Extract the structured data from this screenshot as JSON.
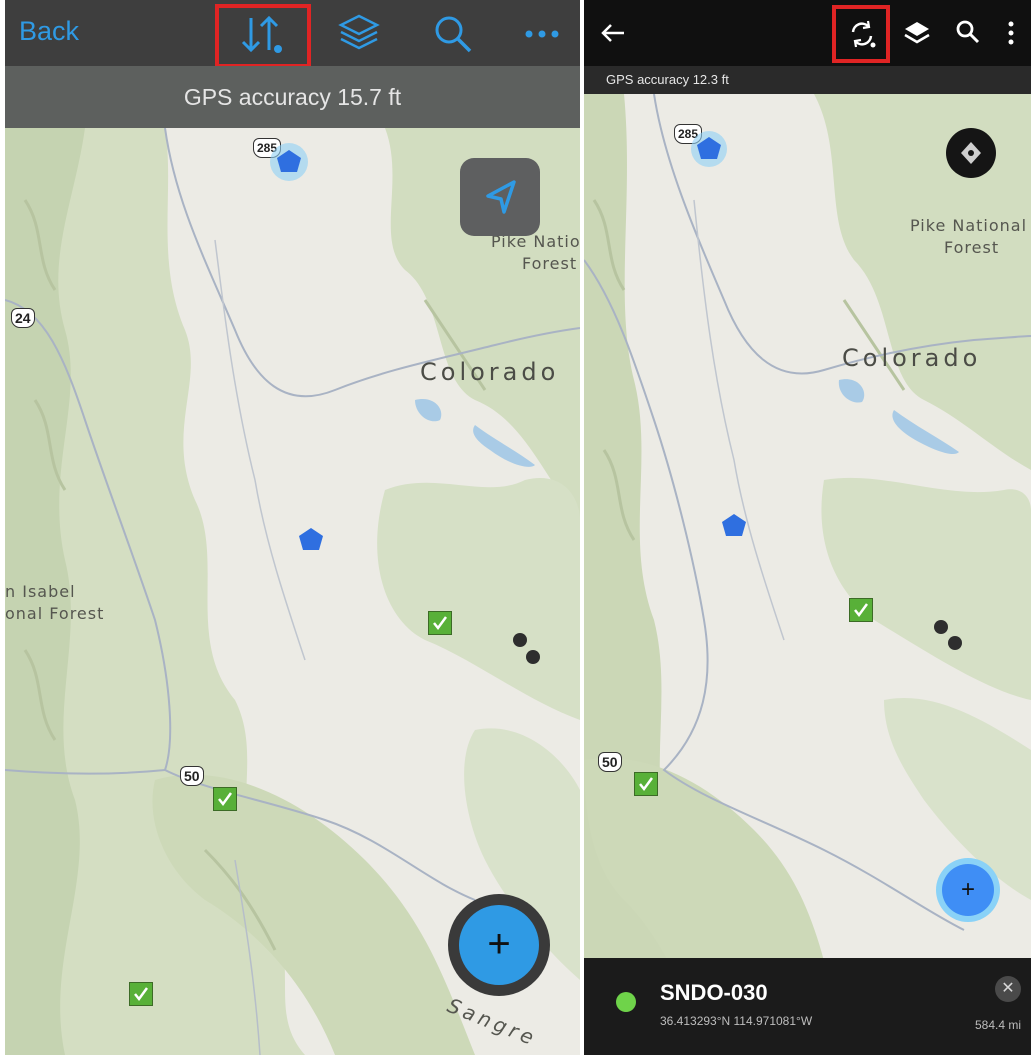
{
  "left": {
    "toolbar": {
      "back_label": "Back"
    },
    "gps_accuracy": "GPS accuracy 15.7 ft",
    "map_labels": {
      "forest_pike_line1": "Pike Natio",
      "forest_pike_line2": "Forest",
      "state": "Colorado",
      "forest_sanisabel_line1": "n Isabel",
      "forest_sanisabel_line2": "onal Forest",
      "range": "Sangre"
    },
    "shields": {
      "us285": "285",
      "us24": "24",
      "us50": "50"
    },
    "add_button": "+"
  },
  "right": {
    "gps_accuracy": "GPS accuracy 12.3 ft",
    "map_labels": {
      "forest_pike_line1": "Pike National",
      "forest_pike_line2": "Forest",
      "state": "Colorado"
    },
    "shields": {
      "us285": "285",
      "us50": "50"
    },
    "add_button": "+",
    "feature": {
      "title": "SNDO-030",
      "coords": "36.413293°N 114.971081°W",
      "distance": "584.4 mi",
      "status_color": "#6fd34a"
    }
  },
  "colors": {
    "accent_blue": "#2f9ae4",
    "highlight_red": "#e02424",
    "feature_green": "#58b038",
    "pentagon_blue": "#2f6fe0"
  },
  "icons": [
    "sync-sort-icon",
    "layers-icon",
    "search-icon",
    "more-icon",
    "navigate-arrow-icon",
    "back-arrow-icon",
    "sync-icon",
    "compass-icon",
    "close-icon",
    "add-icon",
    "check-icon"
  ]
}
